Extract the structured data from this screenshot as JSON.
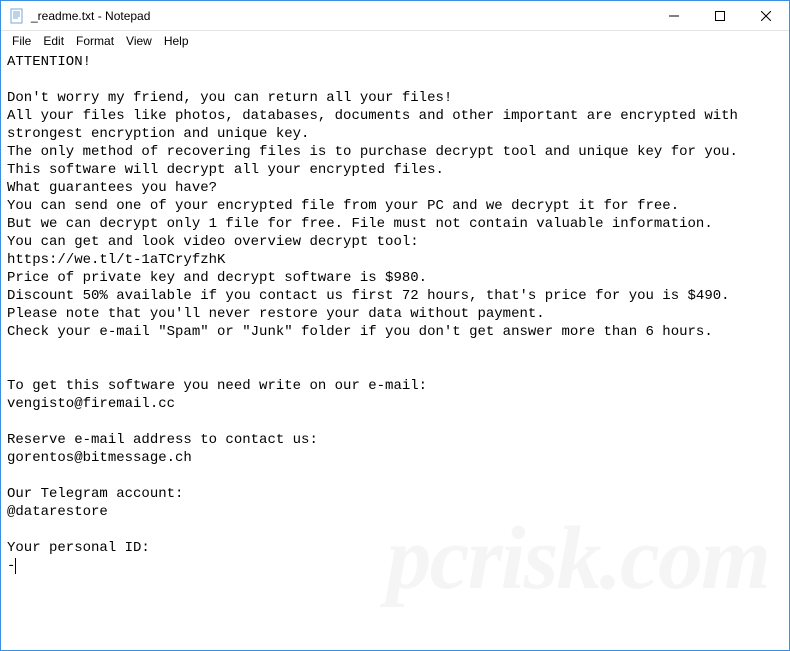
{
  "window": {
    "title": "_readme.txt - Notepad"
  },
  "menubar": {
    "file": "File",
    "edit": "Edit",
    "format": "Format",
    "view": "View",
    "help": "Help"
  },
  "document": {
    "text": "ATTENTION!\n\nDon't worry my friend, you can return all your files!\nAll your files like photos, databases, documents and other important are encrypted with strongest encryption and unique key.\nThe only method of recovering files is to purchase decrypt tool and unique key for you.\nThis software will decrypt all your encrypted files.\nWhat guarantees you have?\nYou can send one of your encrypted file from your PC and we decrypt it for free.\nBut we can decrypt only 1 file for free. File must not contain valuable information.\nYou can get and look video overview decrypt tool:\nhttps://we.tl/t-1aTCryfzhK\nPrice of private key and decrypt software is $980.\nDiscount 50% available if you contact us first 72 hours, that's price for you is $490.\nPlease note that you'll never restore your data without payment.\nCheck your e-mail \"Spam\" or \"Junk\" folder if you don't get answer more than 6 hours.\n\n\nTo get this software you need write on our e-mail:\nvengisto@firemail.cc\n\nReserve e-mail address to contact us:\ngorentos@bitmessage.ch\n\nOur Telegram account:\n@datarestore\n\nYour personal ID:\n-"
  }
}
